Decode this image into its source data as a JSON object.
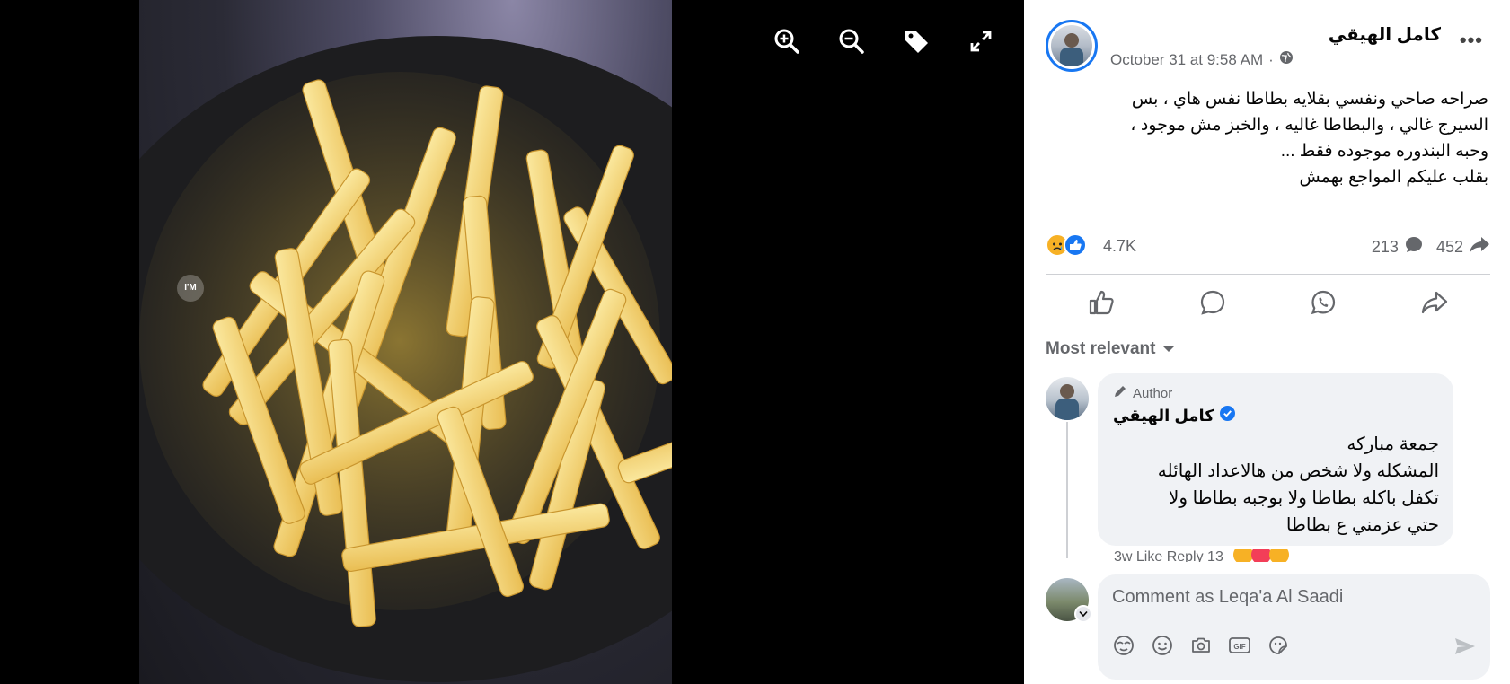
{
  "viewer": {
    "tools": [
      "zoom-in-icon",
      "zoom-out-icon",
      "tag-icon",
      "fullscreen-icon"
    ],
    "watermark": "I'M"
  },
  "post": {
    "author": "كامل الهيقي",
    "timestamp": "October 31 at 9:58 AM",
    "separator": "·",
    "privacy_icon": "globe-icon",
    "more_label": "•••",
    "body_lines": [
      "صراحه صاحي ونفسي بقلايه بطاطا نفس هاي ، بس",
      "السيرج غالي ، والبطاطا غاليه ، والخبز مش موجود ،",
      "وحبه البندوره موجوده فقط ...",
      "بقلب عليكم المواجع بهمش"
    ],
    "reaction_count": "4.7K",
    "comment_count": "213",
    "share_count": "452",
    "reaction_icons": [
      "sad-icon",
      "like-icon"
    ],
    "colors": {
      "like": "#1877f2",
      "sad": "#f7b125"
    }
  },
  "actions": [
    "like-button",
    "comment-button",
    "whatsapp-button",
    "share-button"
  ],
  "comments": {
    "sort_label": "Most relevant",
    "items": [
      {
        "badge": "Author",
        "name": "كامل الهيقي",
        "verified": true,
        "lines": [
          "جمعة مباركه",
          "المشكله ولا شخص من هالاعداد الهائله",
          "تكفل باكله بطاطا ولا بوجبه بطاطا ولا",
          "حتي عزمني ع بطاطا"
        ],
        "footer_partial": "3w   Like   Reply   13"
      }
    ]
  },
  "composer": {
    "placeholder": "Comment as Leqa'a Al Saadi",
    "tools": [
      "avatar-sticker-icon",
      "emoji-icon",
      "camera-icon",
      "gif-icon",
      "sticker-icon"
    ]
  }
}
